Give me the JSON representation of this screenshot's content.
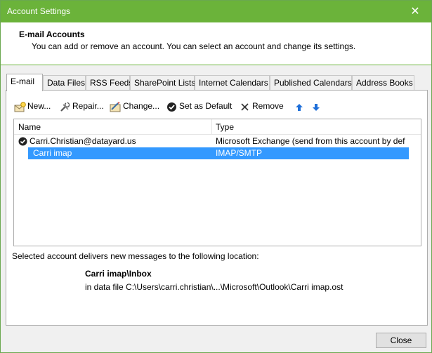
{
  "window": {
    "title": "Account Settings",
    "close_glyph": "✕"
  },
  "header": {
    "title": "E-mail Accounts",
    "subtitle": "You can add or remove an account. You can select an account and change its settings."
  },
  "tabs": [
    {
      "label": "E-mail",
      "active": true
    },
    {
      "label": "Data Files"
    },
    {
      "label": "RSS Feeds"
    },
    {
      "label": "SharePoint Lists"
    },
    {
      "label": "Internet Calendars"
    },
    {
      "label": "Published Calendars"
    },
    {
      "label": "Address Books"
    }
  ],
  "toolbar": {
    "new_label": "New...",
    "repair_label": "Repair...",
    "change_label": "Change...",
    "default_label": "Set as Default",
    "remove_label": "Remove"
  },
  "accounts_list": {
    "columns": {
      "name": "Name",
      "type": "Type"
    },
    "rows": [
      {
        "name": "Carri.Christian@datayard.us",
        "type": "Microsoft Exchange (send from this account by def...",
        "default": true,
        "selected": false
      },
      {
        "name": "Carri imap",
        "type": "IMAP/SMTP",
        "default": false,
        "selected": true
      }
    ]
  },
  "delivery": {
    "label": "Selected account delivers new messages to the following location:",
    "folder": "Carri imap\\Inbox",
    "file": "in data file C:\\Users\\carri.christian\\...\\Microsoft\\Outlook\\Carri imap.ost"
  },
  "footer": {
    "close_label": "Close"
  },
  "colors": {
    "title_bar": "#6bb33a",
    "selection": "#3399ff",
    "arrow_blue": "#1e6fd9"
  }
}
